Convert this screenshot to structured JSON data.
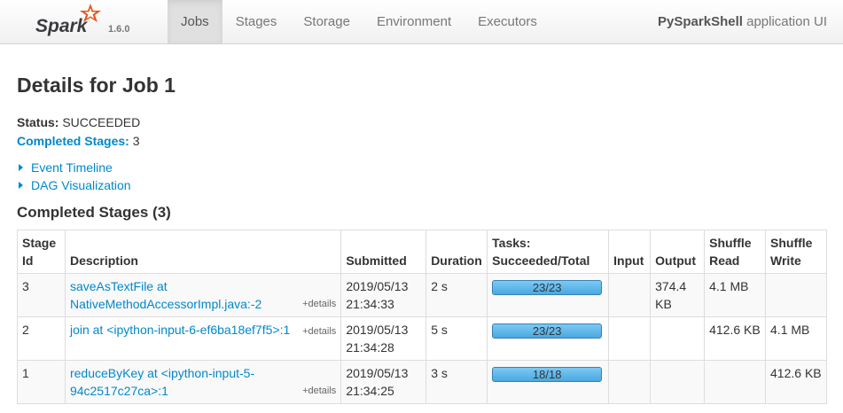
{
  "navbar": {
    "logo_text": "Spark",
    "version": "1.6.0",
    "tabs": [
      {
        "label": "Jobs",
        "active": true
      },
      {
        "label": "Stages",
        "active": false
      },
      {
        "label": "Storage",
        "active": false
      },
      {
        "label": "Environment",
        "active": false
      },
      {
        "label": "Executors",
        "active": false
      }
    ],
    "app_name": "PySparkShell",
    "app_suffix": " application UI"
  },
  "page": {
    "title": "Details for Job 1",
    "status_label": "Status:",
    "status_value": " SUCCEEDED",
    "completed_label": "Completed Stages:",
    "completed_value": " 3",
    "event_timeline": "Event Timeline",
    "dag_visualization": "DAG Visualization",
    "section_title": "Completed Stages (3)"
  },
  "colors": {
    "link": "#0088cc",
    "progress": "#5fb9ee"
  },
  "table": {
    "headers": [
      "Stage Id",
      "Description",
      "Submitted",
      "Duration",
      "Tasks: Succeeded/Total",
      "Input",
      "Output",
      "Shuffle Read",
      "Shuffle Write"
    ],
    "rows": [
      {
        "id": "3",
        "description": "saveAsTextFile at NativeMethodAccessorImpl.java:-2",
        "details": "+details",
        "submitted": "2019/05/13 21:34:33",
        "duration": "2 s",
        "tasks_text": "23/23",
        "tasks_done": 23,
        "tasks_total": 23,
        "input": "",
        "output": "374.4 KB",
        "shuffle_read": "4.1 MB",
        "shuffle_write": ""
      },
      {
        "id": "2",
        "description": "join at <ipython-input-6-ef6ba18ef7f5>:1",
        "details": "+details",
        "submitted": "2019/05/13 21:34:28",
        "duration": "5 s",
        "tasks_text": "23/23",
        "tasks_done": 23,
        "tasks_total": 23,
        "input": "",
        "output": "",
        "shuffle_read": "412.6 KB",
        "shuffle_write": "4.1 MB"
      },
      {
        "id": "1",
        "description": "reduceByKey at <ipython-input-5-94c2517c27ca>:1",
        "details": "+details",
        "submitted": "2019/05/13 21:34:25",
        "duration": "3 s",
        "tasks_text": "18/18",
        "tasks_done": 18,
        "tasks_total": 18,
        "input": "",
        "output": "",
        "shuffle_read": "",
        "shuffle_write": "412.6 KB"
      }
    ]
  }
}
